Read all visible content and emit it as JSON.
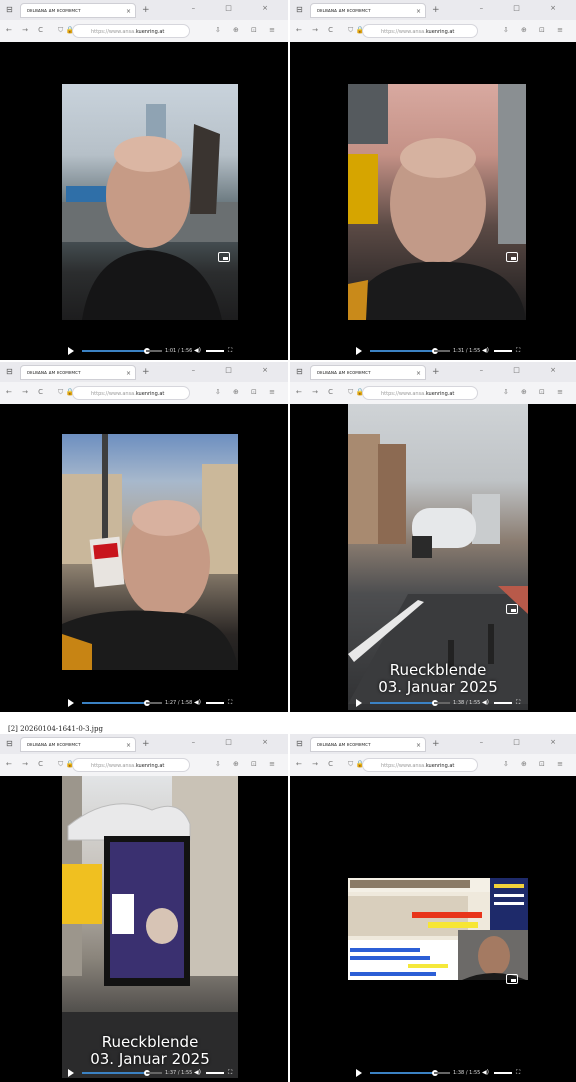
{
  "file_label": "[2] 20260104-1641-0-3.jpg",
  "browser": {
    "tab_title": "ᴅᴇʟʙᴀɴᴀ ᴀᴍ ᴇᴄᴏᴍᴇᴍᴄᴛ",
    "url_prefix": "https://www.ansa.",
    "url_host": "kuenring.at",
    "new_tab": "+",
    "tab_close": "×",
    "window_buttons": "–  □  ×",
    "nav_buttons": "←  →  C",
    "url_icons": "⛉ 🔒",
    "tool_icons": "⇩ ⊕ ⊡ ≡"
  },
  "panels": [
    {
      "time": "1:01 / 1:56"
    },
    {
      "time": "1:31 / 1:55"
    },
    {
      "time": "1:27 / 1:58"
    },
    {
      "time": "1:38 / 1:55",
      "caption_line1": "Rueckblende",
      "caption_line2": "03. Januar 2025"
    },
    {
      "time": "1:37 / 1:55",
      "caption_line1": "Rueckblende",
      "caption_line2": "03. Januar 2025"
    },
    {
      "time": "1:38 / 1:55"
    }
  ],
  "colors": {
    "accent": "#3b82c4",
    "video_bg": "#000000",
    "chrome_bg": "#f4f4f6"
  }
}
